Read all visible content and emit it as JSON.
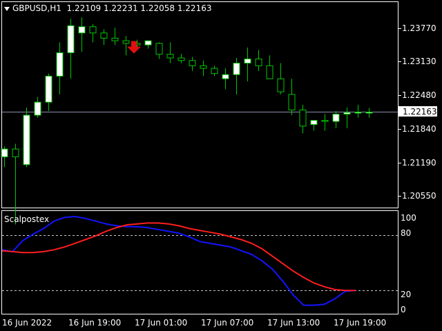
{
  "header": {
    "symbol_timeframe": "GBPUSD,H1",
    "ohlc": "1.22109 1.22231 1.22058 1.22163"
  },
  "price_axis": {
    "ticks": [
      "1.23770",
      "1.23130",
      "1.22480",
      "1.21840",
      "1.21190",
      "1.20550"
    ],
    "current_price": "1.22163"
  },
  "time_axis": {
    "labels": [
      "16 Jun 2022",
      "16 Jun 19:00",
      "17 Jun 01:00",
      "17 Jun 07:00",
      "17 Jun 13:00",
      "17 Jun 19:00"
    ]
  },
  "subwindow": {
    "name": "Scalpostex",
    "ticks": [
      "100",
      "80",
      "20",
      "0"
    ],
    "levels": [
      80,
      20
    ]
  },
  "colors": {
    "background": "#000000",
    "border": "#ffffff",
    "bull_candle": "#ffffff",
    "bear_candle": "#000000",
    "wick": "#00c800",
    "price_line": "#8a8fb0",
    "arrow": "#e01010",
    "fast_line": "#1414ff",
    "slow_line": "#ff1e1e",
    "level_line": "#c8c8c8"
  },
  "chart_data": [
    {
      "type": "candlestick",
      "title": "GBPUSD,H1",
      "x": [
        "16 Jun 2022",
        "",
        "",
        "",
        "",
        "",
        "",
        "16 Jun 19:00",
        "",
        "",
        "",
        "",
        "",
        "17 Jun 01:00",
        "",
        "",
        "",
        "",
        "",
        "17 Jun 07:00",
        "",
        "",
        "",
        "",
        "",
        "17 Jun 13:00",
        "",
        "",
        "",
        "",
        "",
        "17 Jun 19:00",
        "",
        ""
      ],
      "open": [
        1.213,
        1.2145,
        1.2115,
        1.221,
        1.2235,
        1.2285,
        1.233,
        1.2368,
        1.238,
        1.2368,
        1.2358,
        1.2353,
        1.2348,
        1.2345,
        1.2348,
        1.2327,
        1.232,
        1.2315,
        1.2305,
        1.23,
        1.228,
        1.2288,
        1.231,
        1.2318,
        1.2305,
        1.228,
        1.225,
        1.222,
        1.2192,
        1.22,
        1.2198,
        1.2212,
        1.2215,
        1.2216
      ],
      "high": [
        1.215,
        1.2155,
        1.2225,
        1.2245,
        1.229,
        1.235,
        1.2395,
        1.2398,
        1.2385,
        1.2375,
        1.2378,
        1.2362,
        1.2355,
        1.235,
        1.235,
        1.235,
        1.2328,
        1.2322,
        1.2315,
        1.2305,
        1.23,
        1.232,
        1.234,
        1.2335,
        1.2325,
        1.231,
        1.228,
        1.223,
        1.22,
        1.2212,
        1.2218,
        1.2225,
        1.223,
        1.2224
      ],
      "low": [
        1.211,
        1.2,
        1.211,
        1.2205,
        1.2218,
        1.225,
        1.228,
        1.2332,
        1.235,
        1.2345,
        1.2345,
        1.2325,
        1.234,
        1.2338,
        1.2318,
        1.231,
        1.231,
        1.2295,
        1.2285,
        1.2285,
        1.226,
        1.225,
        1.2275,
        1.2295,
        1.2285,
        1.225,
        1.221,
        1.2175,
        1.218,
        1.218,
        1.2185,
        1.2185,
        1.2205,
        1.2205
      ],
      "close": [
        1.2145,
        1.213,
        1.221,
        1.2235,
        1.2285,
        1.233,
        1.2382,
        1.238,
        1.2368,
        1.2358,
        1.2353,
        1.2348,
        1.2345,
        1.2353,
        1.2327,
        1.232,
        1.2315,
        1.2305,
        1.23,
        1.229,
        1.2288,
        1.231,
        1.2318,
        1.2305,
        1.228,
        1.2255,
        1.222,
        1.2189,
        1.22,
        1.2198,
        1.2212,
        1.2215,
        1.2216,
        1.2216
      ],
      "ylim": [
        1.2,
        1.24
      ],
      "current_price": 1.22163,
      "sell_arrow_index": 12
    },
    {
      "type": "line",
      "title": "Scalpostex",
      "x": [
        "16 Jun 2022",
        "16 Jun 19:00",
        "17 Jun 01:00",
        "17 Jun 07:00",
        "17 Jun 13:00",
        "17 Jun 19:00"
      ],
      "series": [
        {
          "values": [
            64,
            62,
            74,
            81,
            87,
            95,
            99,
            100,
            98,
            95,
            92,
            90,
            89,
            89,
            88,
            86,
            84,
            82,
            78,
            73,
            71,
            69,
            67,
            63,
            59,
            52,
            43,
            30,
            15,
            4,
            4,
            5,
            11,
            19,
            20
          ]
        },
        {
          "values": [
            63,
            62,
            61,
            61,
            62,
            64,
            67,
            71,
            75,
            79,
            84,
            88,
            91,
            92,
            93,
            93,
            92,
            90,
            87,
            85,
            83,
            81,
            78,
            75,
            71,
            65,
            57,
            49,
            41,
            34,
            28,
            24,
            21,
            20,
            20
          ]
        }
      ],
      "ylim": [
        0,
        100
      ]
    }
  ]
}
